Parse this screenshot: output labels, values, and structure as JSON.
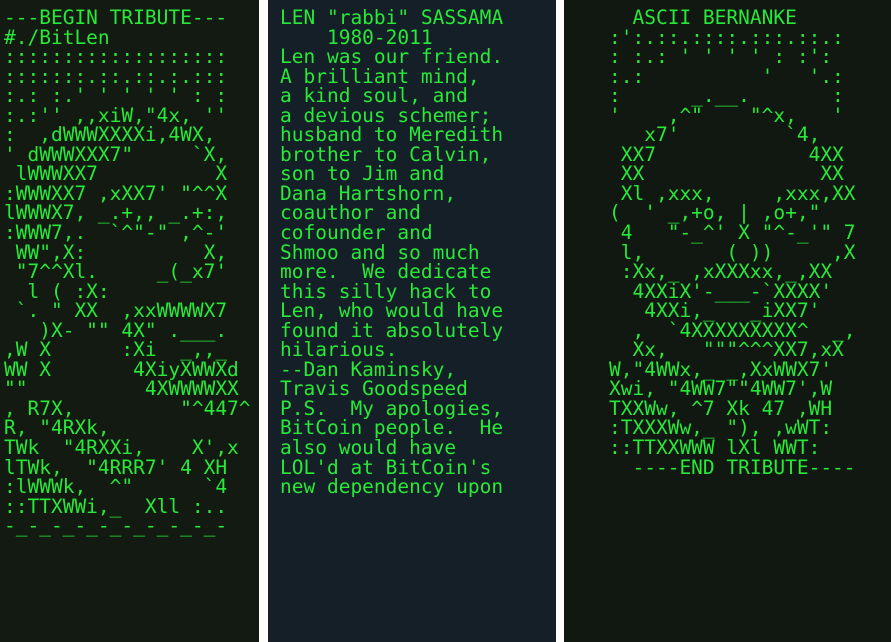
{
  "panels": {
    "left": [
      "---BEGIN TRIBUTE---",
      "#./BitLen",
      ":::::::::::::::::::",
      ":::::::.::.::.:.:::",
      ":.: :.' ' ' ' ' : :",
      ":.:'' ,,xiW,\"4x, ''",
      ":  ,dWWWXXXXi,4WX,",
      "' dWWWXXX7\"     `X,",
      " lWWWXX7          X",
      ":WWWXX7 ,xXX7' \"^^X",
      "lWWWX7, _.+,, _.+:,",
      ":WWW7,.  `^\"-\" ,^-'",
      " WW\",X:          X,",
      " \"7^^Xl.     _(_x7'",
      "  l ( :X:",
      " `. \" XX  ,xxWWWWX7",
      "   )X- \"\" 4X\" .___.",
      ",W X      :Xi  _,,_",
      "WW X       4XiyXWWXd",
      "\"\"          4XWWWWXX",
      ", R7X,         \"^447^",
      "R, \"4RXk,",
      "TWk  \"4RXXi,    X',x",
      "lTWk,  \"4RRR7' 4 XH",
      ":lWWWk,  ^\"      `4",
      "::TTXWWi,_  Xll :..",
      "-_-_-_-_-_-_-_-_-_-"
    ],
    "middle": [
      "LEN \"rabbi\" SASSAMA",
      "    1980-2011",
      "Len was our friend.",
      "A brilliant mind,",
      "a kind soul, and",
      "a devious schemer;",
      "husband to Meredith",
      "brother to Calvin,",
      "son to Jim and",
      "Dana Hartshorn,",
      "coauthor and",
      "cofounder and",
      "Shmoo and so much",
      "more.  We dedicate",
      "this silly hack to",
      "Len, who would have",
      "found it absolutely",
      "hilarious.",
      "--Dan Kaminsky,",
      "Travis Goodspeed",
      "P.S.  My apologies,",
      "BitCoin people.  He",
      "also would have",
      "LOL'd at BitCoin's",
      "new dependency upon"
    ],
    "right": [
      "  ASCII BERNANKE",
      ":':.::.::::.:::.::.:",
      ": :.: ' ' ' ' : :':",
      ":.:          '   '.:",
      ":      _.__.       :",
      "'    ,^\"    \"^x,   '",
      "   x7'         `4,",
      " XX7             4XX",
      " XX               XX",
      " Xl ,xxx,     ,xxx,XX",
      "(  ' _,+o, | ,o+,\"",
      " 4   \"-_^' X \"^-_'\" 7",
      " l,       ( ))     ,X",
      " :Xx,_ ,xXXXxx,_,XX",
      "  4XXiX'-___-`XXXX'",
      "   4XXi,_   _iXX7'",
      "  ,  `4XXXXXXXXX^  _,",
      "  Xx,   \"\"\"^^^XX7,xX",
      "W,\"4WWx,_ _,XxWWX7'",
      "Xwi, \"4WW7\"\"4WW7',W",
      "TXXWw, ^7 Xk 47 ,WH",
      ":TXXXWw,_ \"), ,wWT:",
      "::TTXXWWW lXl WWT:",
      "  ----END TRIBUTE----"
    ]
  }
}
